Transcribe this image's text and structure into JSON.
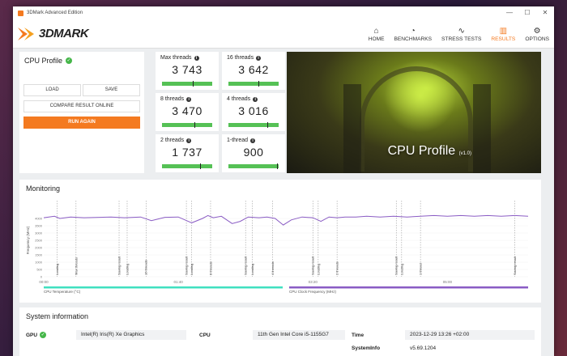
{
  "window": {
    "title": "3DMark Advanced Edition",
    "controls": [
      "—",
      "☐",
      "✕"
    ]
  },
  "header": {
    "logo_text": "3DMARK",
    "nav": [
      {
        "label": "HOME",
        "icon": "home-icon",
        "glyph": "⌂"
      },
      {
        "label": "BENCHMARKS",
        "icon": "gauge-icon",
        "glyph": "◔"
      },
      {
        "label": "STRESS TESTS",
        "icon": "activity-icon",
        "glyph": "∿"
      },
      {
        "label": "RESULTS",
        "icon": "bar-chart-icon",
        "glyph": "▥"
      },
      {
        "label": "OPTIONS",
        "icon": "gear-icon",
        "glyph": "⚙"
      }
    ],
    "active": "RESULTS",
    "accent": "#f47a20"
  },
  "cpu_profile": {
    "title": "CPU Profile",
    "load_label": "LOAD",
    "save_label": "SAVE",
    "compare_label": "COMPARE RESULT ONLINE",
    "run_label": "RUN AGAIN"
  },
  "scores": [
    {
      "label": "Max threads",
      "value": "3 743",
      "marker": 0.62
    },
    {
      "label": "16 threads",
      "value": "3 642",
      "marker": 0.6
    },
    {
      "label": "8 threads",
      "value": "3 470",
      "marker": 0.65
    },
    {
      "label": "4 threads",
      "value": "3 016",
      "marker": 0.77
    },
    {
      "label": "2 threads",
      "value": "1 737",
      "marker": 0.75
    },
    {
      "label": "1-thread",
      "value": "900",
      "marker": 0.97
    }
  ],
  "hero": {
    "title": "CPU Profile",
    "version": "(v1.0)"
  },
  "monitoring": {
    "title": "Monitoring"
  },
  "chart_data": {
    "type": "line",
    "ylabel": "Frequency (MHz)",
    "ylim": [
      0,
      5000
    ],
    "yticks": [
      "4000",
      "3500",
      "3000",
      "2500",
      "2000",
      "1500",
      "1000",
      "500",
      "0"
    ],
    "xticks": [
      "00:00",
      "01:40",
      "03:20",
      "05:00"
    ],
    "x_range": [
      0,
      360
    ],
    "series": [
      {
        "name": "CPU Clock Frequency (MHz)",
        "color": "#8a5cc4",
        "x": [
          0,
          8,
          12,
          20,
          30,
          50,
          60,
          72,
          80,
          90,
          100,
          110,
          118,
          122,
          126,
          132,
          140,
          146,
          152,
          160,
          166,
          172,
          178,
          184,
          192,
          200,
          206,
          212,
          218,
          224,
          232,
          240,
          250,
          260,
          270,
          280,
          290,
          300,
          310,
          320,
          330,
          340,
          350,
          360
        ],
        "y": [
          4050,
          4150,
          4000,
          4100,
          4050,
          4100,
          4050,
          4100,
          3850,
          4080,
          4100,
          3700,
          4000,
          4200,
          4050,
          4150,
          3650,
          3800,
          4100,
          4050,
          4100,
          4000,
          3550,
          3900,
          4100,
          4050,
          3800,
          4100,
          4050,
          4100,
          4100,
          4150,
          4100,
          4150,
          4100,
          4150,
          4200,
          4150,
          4200,
          4150,
          4200,
          4150,
          4200,
          4150
        ]
      }
    ],
    "legend": [
      {
        "name": "CPU Temperature (°C)",
        "color": "#40e0c0"
      },
      {
        "name": "CPU Clock Frequency (MHz)",
        "color": "#8a5cc4"
      }
    ],
    "annotations": [
      {
        "x": 10,
        "label": "Loading"
      },
      {
        "x": 24,
        "label": "Max threads"
      },
      {
        "x": 56,
        "label": "Saving result"
      },
      {
        "x": 62,
        "label": "Loading"
      },
      {
        "x": 76,
        "label": "16 threads"
      },
      {
        "x": 106,
        "label": "Saving result"
      },
      {
        "x": 110,
        "label": "Loading"
      },
      {
        "x": 124,
        "label": "8 threads"
      },
      {
        "x": 150,
        "label": "Saving result"
      },
      {
        "x": 155,
        "label": "Loading"
      },
      {
        "x": 170,
        "label": "4 threads"
      },
      {
        "x": 200,
        "label": "Saving result"
      },
      {
        "x": 204,
        "label": "Loading"
      },
      {
        "x": 218,
        "label": "2 threads"
      },
      {
        "x": 262,
        "label": "Saving result"
      },
      {
        "x": 266,
        "label": "Loading"
      },
      {
        "x": 280,
        "label": "1 thread"
      },
      {
        "x": 350,
        "label": "Saving result"
      }
    ]
  },
  "system_info": {
    "title": "System information",
    "gpu_label": "GPU",
    "gpu_value": "Intel(R) Iris(R) Xe Graphics",
    "cpu_label": "CPU",
    "cpu_value": "11th Gen Intel Core i5-1155G7",
    "time_label": "Time",
    "time_value": "2023-12-29 13:26 +02:00",
    "row2_label": "SystemInfo",
    "row2_value": "v5.69.1204"
  }
}
